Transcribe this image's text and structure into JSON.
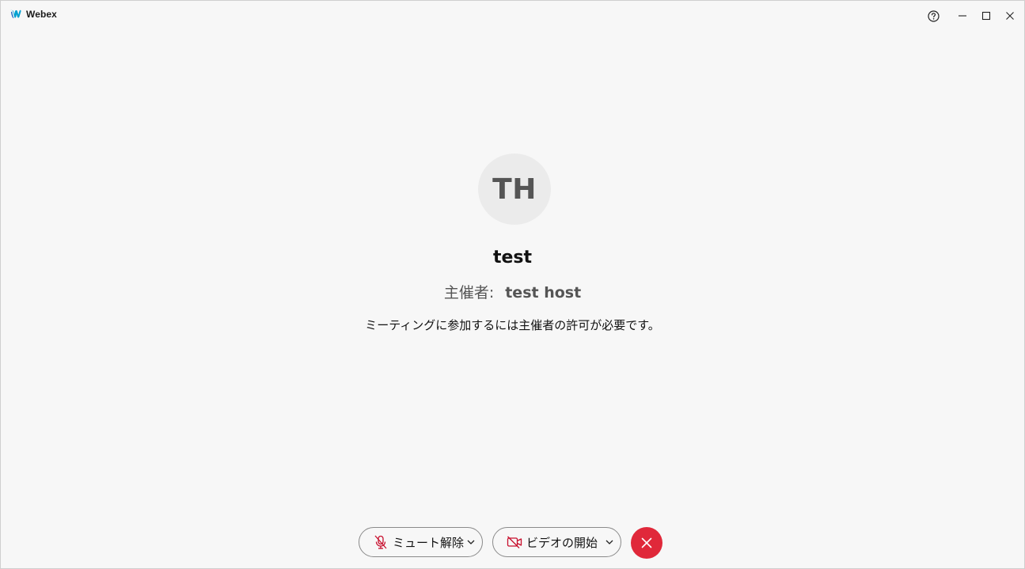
{
  "app": {
    "title": "Webex",
    "logo_icon": "webex-logo-icon"
  },
  "window_controls": {
    "help_icon": "help-circle-icon",
    "minimize_icon": "minimize-icon",
    "maximize_icon": "maximize-icon",
    "close_icon": "close-icon"
  },
  "meeting": {
    "avatar_initials": "TH",
    "name": "test",
    "host_label": "主催者:",
    "host_name": "test host",
    "lobby_message": "ミーティングに参加するには主催者の許可が必要です。"
  },
  "controls": {
    "mute": {
      "label": "ミュート解除",
      "icon": "microphone-muted-icon",
      "dropdown_icon": "chevron-down-icon"
    },
    "video": {
      "label": "ビデオの開始",
      "icon": "video-off-icon",
      "dropdown_icon": "chevron-down-icon"
    },
    "leave": {
      "icon": "close-icon",
      "color": "#e0283a"
    }
  },
  "colors": {
    "background": "#f7f7f7",
    "accent_red": "#e0283a",
    "muted_icon_red": "#c8102e"
  }
}
